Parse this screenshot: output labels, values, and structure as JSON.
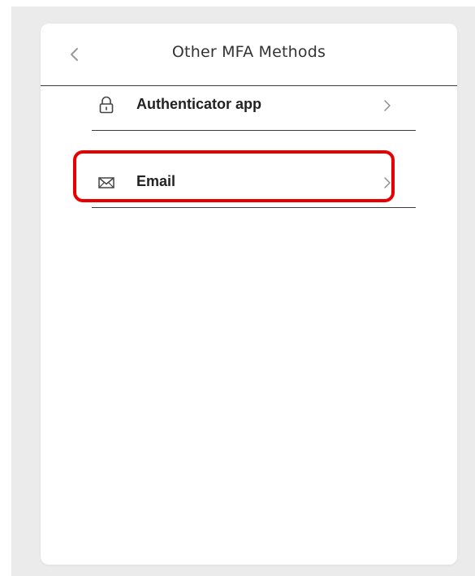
{
  "header": {
    "back_icon": "chevron-left-icon",
    "title": "Other MFA Methods"
  },
  "methods": [
    {
      "label": "Authenticator app",
      "icon": "lock-icon",
      "chevron": "chevron-right-icon"
    },
    {
      "label": "Email",
      "icon": "envelope-icon",
      "chevron": "chevron-right-icon"
    }
  ],
  "annotation": {
    "highlighted_item": "Email",
    "highlight_color": "#e80000"
  },
  "colors": {
    "backdrop": "#ebebeb",
    "panel": "#ffffff",
    "text": "#222222",
    "muted_icon": "#9a9a9a"
  }
}
